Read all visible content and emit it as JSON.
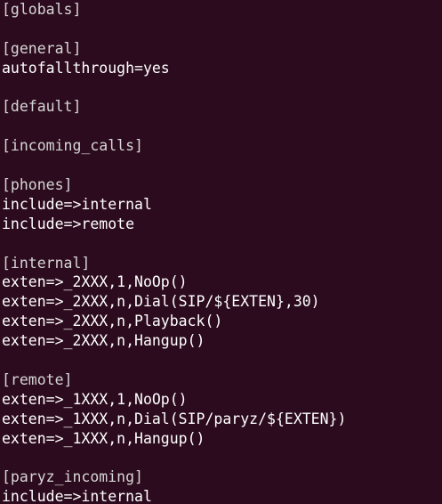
{
  "terminal": {
    "background": "#2c0b1e",
    "section_color": "#d6d6d6",
    "entry_color": "#ffffff",
    "lines": [
      {
        "text": "[globals]",
        "kind": "section"
      },
      {
        "text": "",
        "kind": "blank"
      },
      {
        "text": "[general]",
        "kind": "section"
      },
      {
        "text": "autofallthrough=yes",
        "kind": "entry"
      },
      {
        "text": "",
        "kind": "blank"
      },
      {
        "text": "[default]",
        "kind": "section"
      },
      {
        "text": "",
        "kind": "blank"
      },
      {
        "text": "[incoming_calls]",
        "kind": "section"
      },
      {
        "text": "",
        "kind": "blank"
      },
      {
        "text": "[phones]",
        "kind": "section"
      },
      {
        "text": "include=>internal",
        "kind": "entry"
      },
      {
        "text": "include=>remote",
        "kind": "entry"
      },
      {
        "text": "",
        "kind": "blank"
      },
      {
        "text": "[internal]",
        "kind": "section"
      },
      {
        "text": "exten=>_2XXX,1,NoOp()",
        "kind": "entry"
      },
      {
        "text": "exten=>_2XXX,n,Dial(SIP/${EXTEN},30)",
        "kind": "entry"
      },
      {
        "text": "exten=>_2XXX,n,Playback()",
        "kind": "entry"
      },
      {
        "text": "exten=>_2XXX,n,Hangup()",
        "kind": "entry"
      },
      {
        "text": "",
        "kind": "blank"
      },
      {
        "text": "[remote]",
        "kind": "section"
      },
      {
        "text": "exten=>_1XXX,1,NoOp()",
        "kind": "entry"
      },
      {
        "text": "exten=>_1XXX,n,Dial(SIP/paryz/${EXTEN})",
        "kind": "entry"
      },
      {
        "text": "exten=>_1XXX,n,Hangup()",
        "kind": "entry"
      },
      {
        "text": "",
        "kind": "blank"
      },
      {
        "text": "[paryz_incoming]",
        "kind": "section"
      },
      {
        "text": "include=>internal",
        "kind": "entry"
      }
    ]
  }
}
